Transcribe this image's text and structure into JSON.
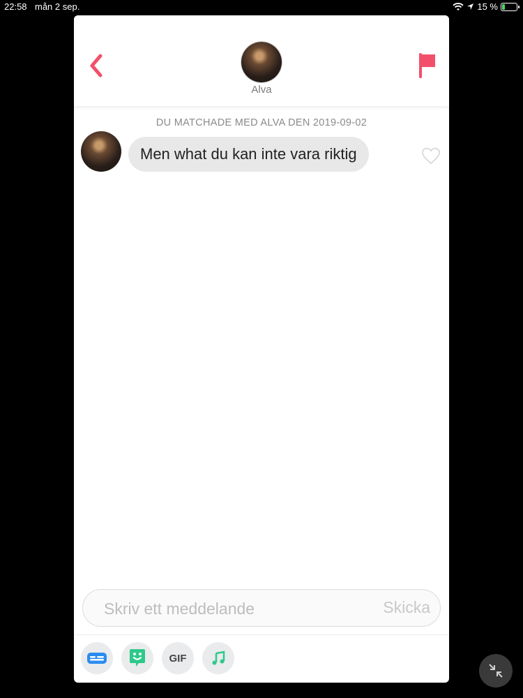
{
  "status_bar": {
    "time": "22:58",
    "date": "mån 2 sep.",
    "battery_percent": "15 %",
    "icons": [
      "wifi-icon",
      "location-arrow-icon",
      "battery-charging-icon"
    ]
  },
  "header": {
    "back_icon": "chevron-left-icon",
    "report_icon": "flag-icon",
    "match_name": "Alva",
    "accent_color": "#f2506a"
  },
  "conversation": {
    "match_info": "DU MATCHADE MED ALVA DEN 2019-09-02",
    "messages": [
      {
        "sender": "Alva",
        "text": "Men what du kan inte vara riktig",
        "liked": false
      }
    ]
  },
  "composer": {
    "placeholder": "Skriv ett meddelande",
    "send_label": "Skicka"
  },
  "toolbar": {
    "items": [
      {
        "icon": "contact-card-icon",
        "label": ""
      },
      {
        "icon": "sticker-icon",
        "label": ""
      },
      {
        "icon": "gif-icon",
        "label": "GIF"
      },
      {
        "icon": "music-note-icon",
        "label": ""
      }
    ]
  },
  "overlay": {
    "minimize_icon": "minimize-arrows-icon"
  }
}
